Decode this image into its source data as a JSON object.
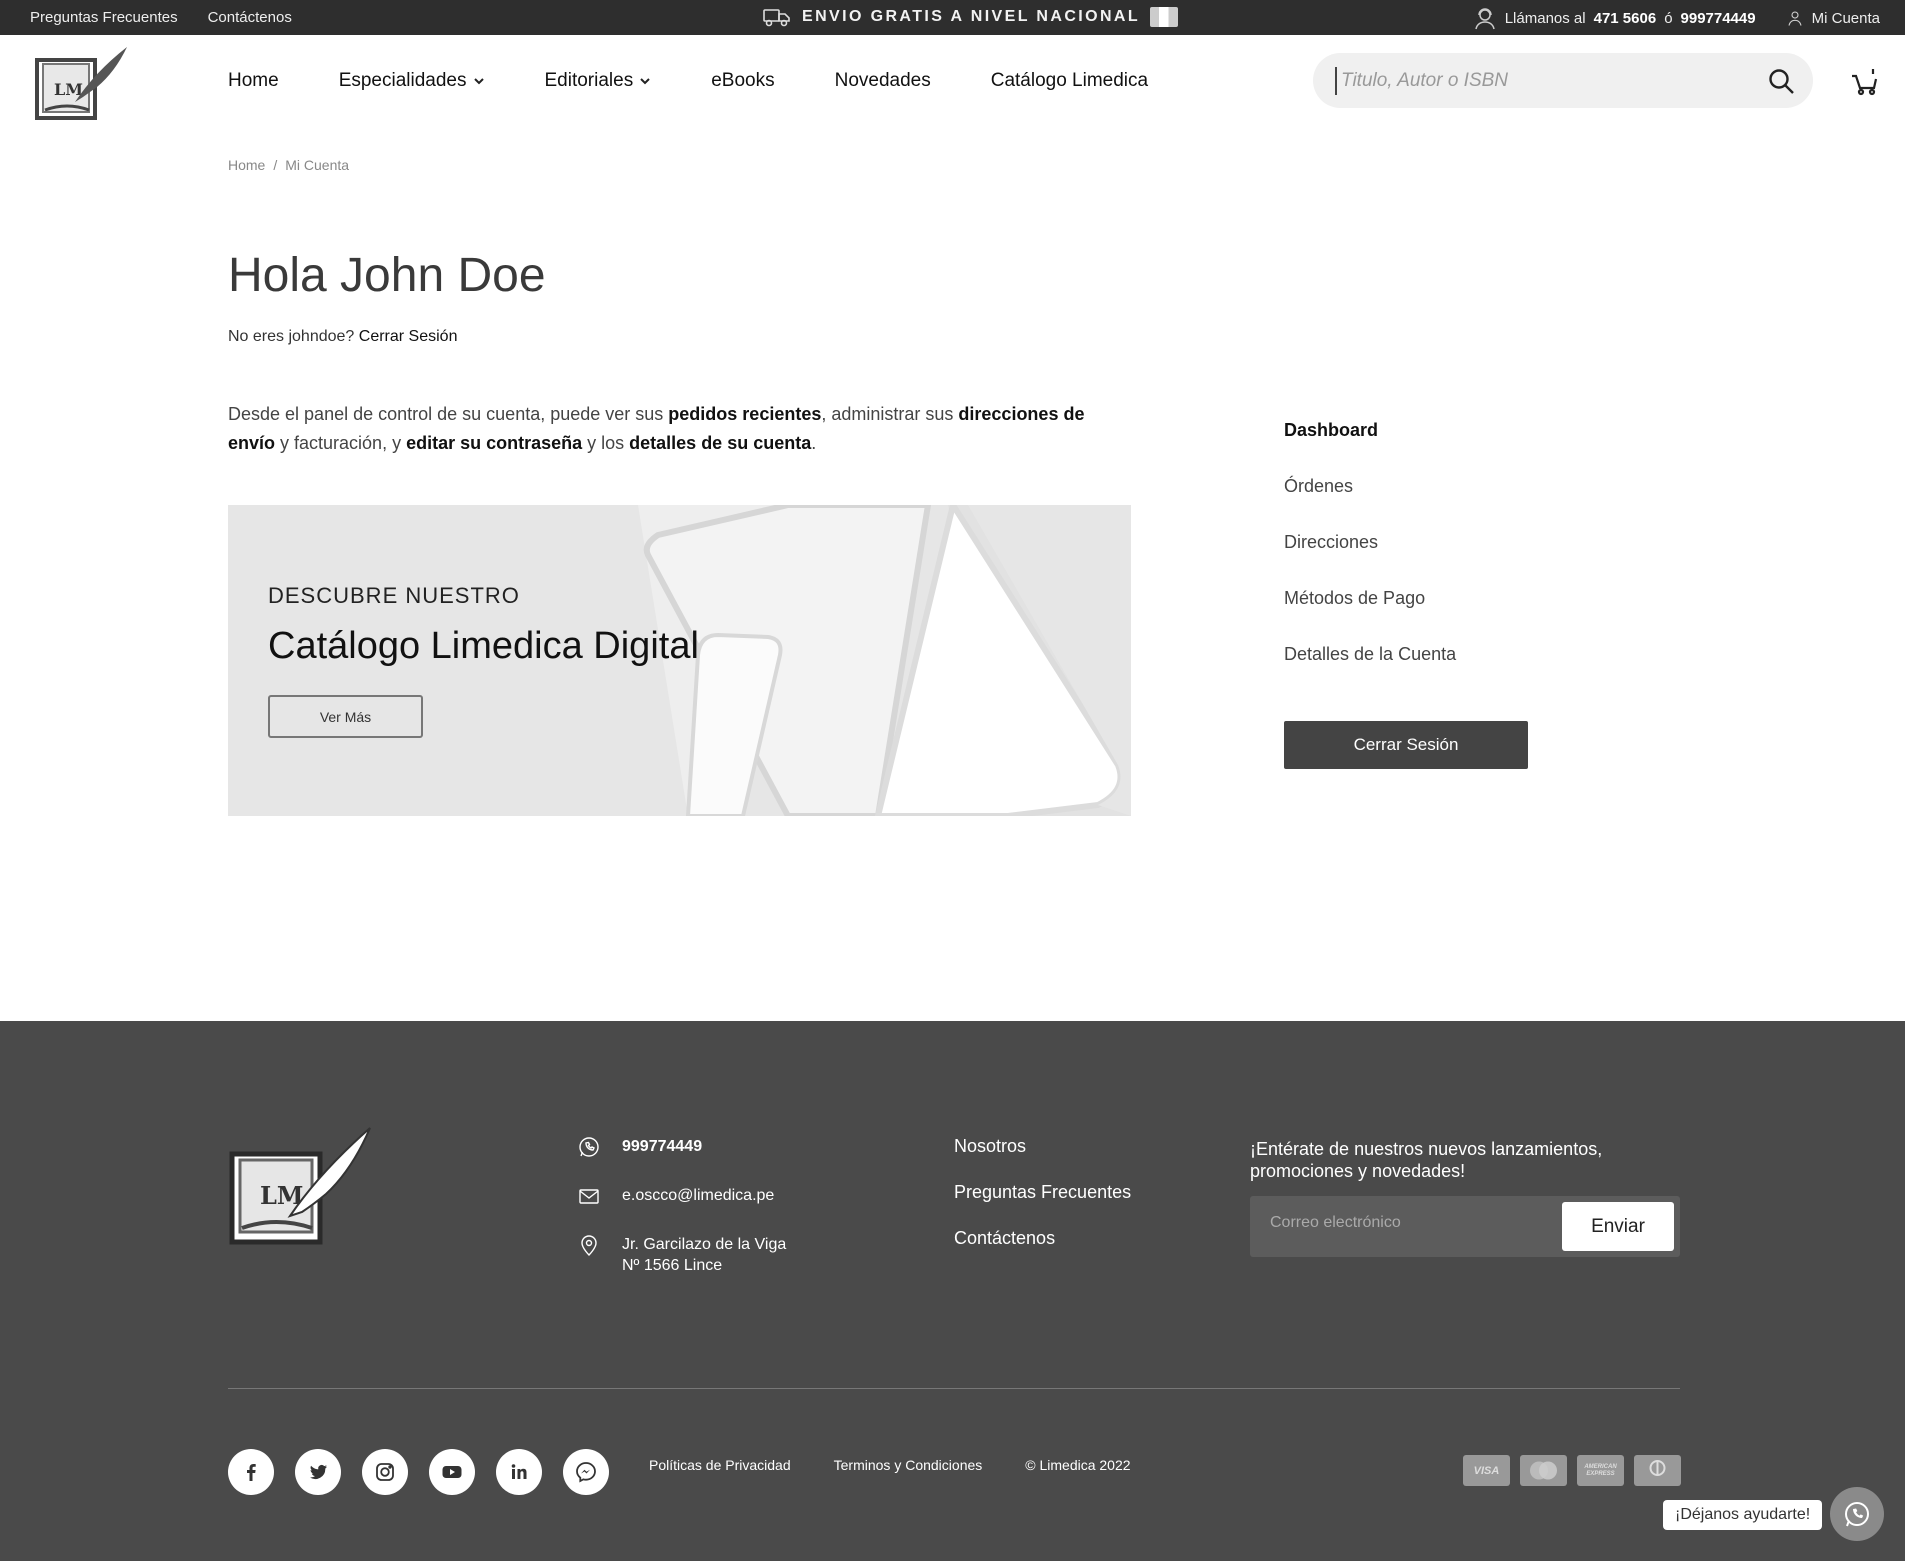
{
  "topbar": {
    "faq": "Preguntas Frecuentes",
    "contact": "Contáctenos",
    "promo": "ENVIO GRATIS A NIVEL NACIONAL",
    "call_prefix": "Llámanos al",
    "phone1": "471 5606",
    "or": "ó",
    "phone2": "999774449",
    "account": "Mi Cuenta"
  },
  "nav": {
    "items": [
      {
        "label": "Home"
      },
      {
        "label": "Especialidades"
      },
      {
        "label": "Editoriales"
      },
      {
        "label": "eBooks"
      },
      {
        "label": "Novedades"
      },
      {
        "label": "Catálogo Limedica"
      }
    ],
    "search_placeholder": "Titulo, Autor o ISBN",
    "logo_text": "LM"
  },
  "breadcrumb": {
    "home": "Home",
    "sep": "/",
    "current": "Mi Cuenta"
  },
  "main": {
    "title": "Hola John Doe",
    "not_you": "No eres johndoe?",
    "logout_link": "Cerrar Sesión",
    "intro": {
      "p1": "Desde el panel de control de su cuenta, puede ver sus ",
      "b1": "pedidos recientes",
      "p2": ", administrar sus ",
      "b2": "direcciones de envío",
      "p3": " y facturación, y ",
      "b3": "editar su contraseña",
      "p4": " y los ",
      "b4": "detalles de su cuenta",
      "p5": "."
    },
    "banner": {
      "kicker": "DESCUBRE NUESTRO",
      "title": "Catálogo Limedica Digital",
      "button": "Ver Más"
    }
  },
  "sidebar": {
    "items": [
      {
        "label": "Dashboard"
      },
      {
        "label": "Órdenes"
      },
      {
        "label": "Direcciones"
      },
      {
        "label": "Métodos de Pago"
      },
      {
        "label": "Detalles de la Cuenta"
      }
    ],
    "logout": "Cerrar Sesión"
  },
  "footer": {
    "phone": "999774449",
    "email": "e.oscco@limedica.pe",
    "address1": "Jr. Garcilazo de la Viga",
    "address2": "Nº 1566 Lince",
    "links": [
      {
        "label": "Nosotros"
      },
      {
        "label": "Preguntas Frecuentes"
      },
      {
        "label": "Contáctenos"
      }
    ],
    "newsletter_text": "¡Entérate de nuestros nuevos lanzamientos, promociones y novedades!",
    "newsletter_placeholder": "Correo electrónico",
    "newsletter_button": "Enviar",
    "legal": [
      "Políticas de Privacidad",
      "Terminos y Condiciones",
      "© Limedica 2022"
    ],
    "payments": [
      "VISA",
      "MasterCard",
      "AMERICAN EXPRESS",
      "Diners Club"
    ],
    "help": "¡Déjanos ayudarte!"
  }
}
